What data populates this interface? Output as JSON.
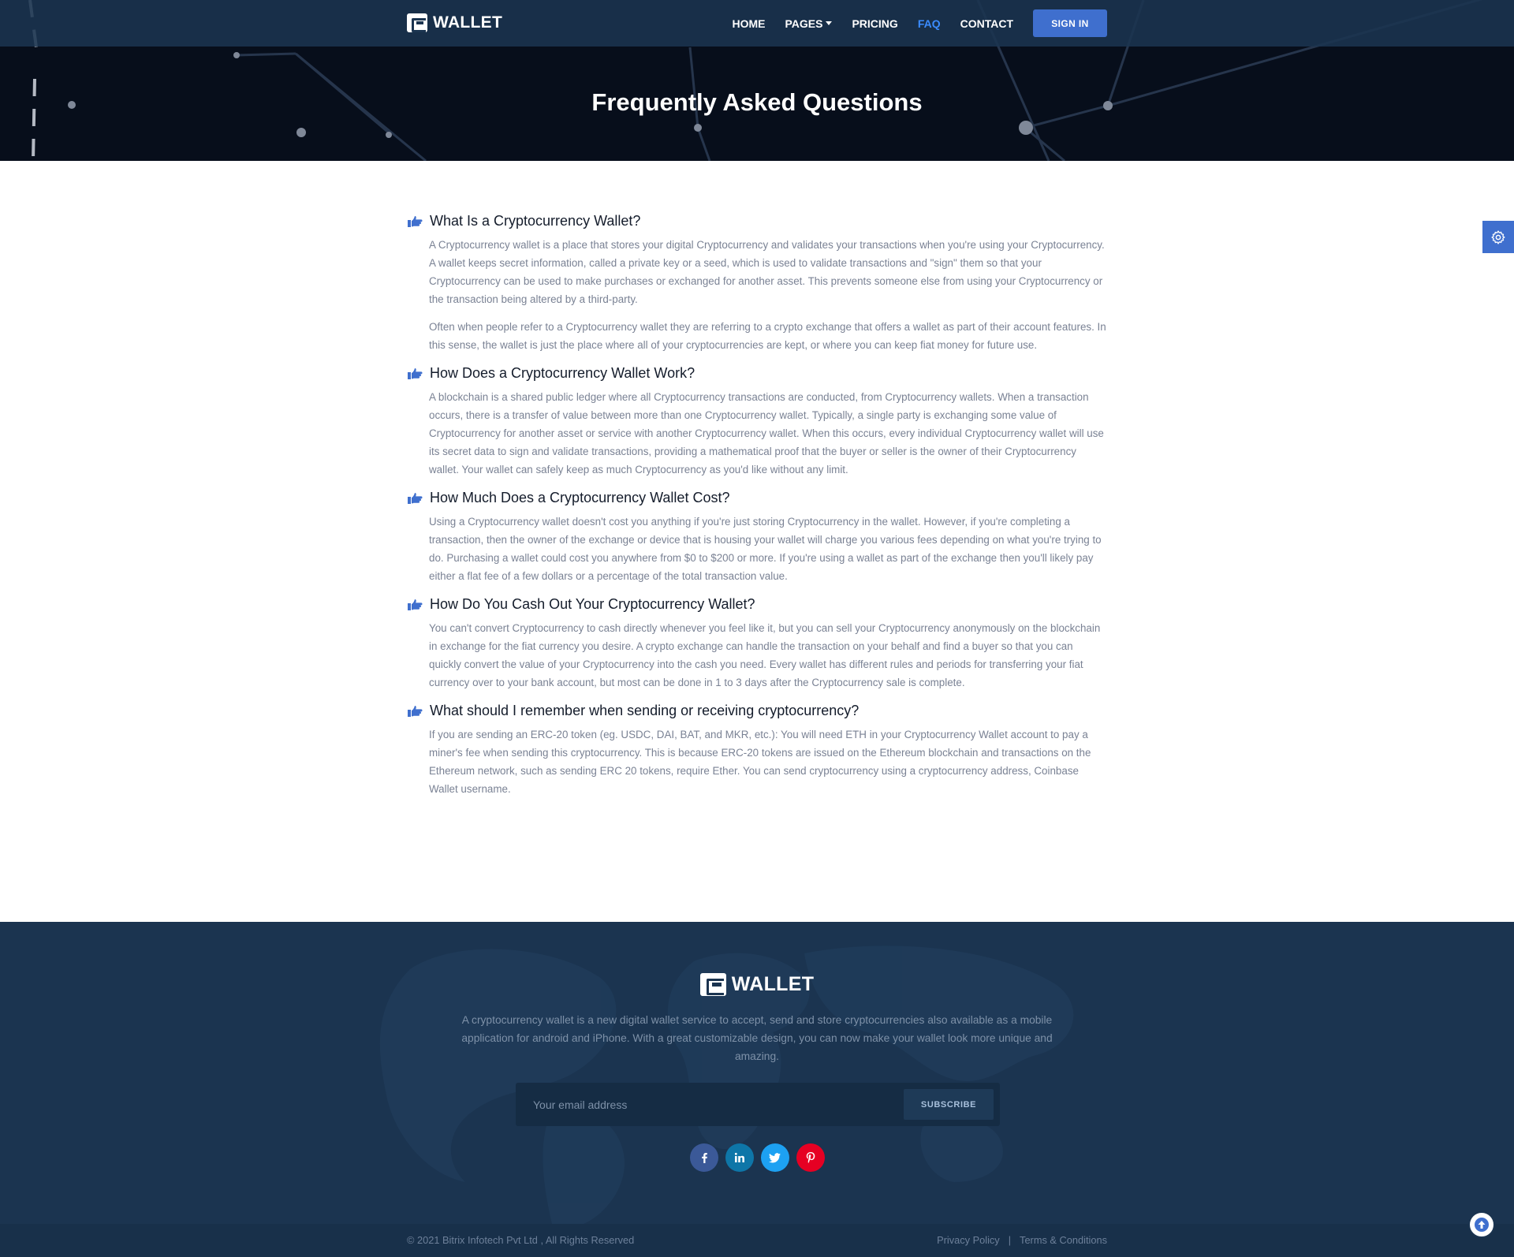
{
  "brand": {
    "name": "WALLET"
  },
  "nav": {
    "items": [
      {
        "label": "HOME",
        "active": false
      },
      {
        "label": "PAGES",
        "active": false,
        "dropdown": true
      },
      {
        "label": "PRICING",
        "active": false
      },
      {
        "label": "FAQ",
        "active": true
      },
      {
        "label": "CONTACT",
        "active": false
      }
    ],
    "signin_label": "SIGN IN"
  },
  "hero": {
    "title": "Frequently Asked Questions"
  },
  "faq": [
    {
      "question": "What Is a Cryptocurrency Wallet?",
      "answers": [
        "A Cryptocurrency wallet is a place that stores your digital Cryptocurrency and validates your transactions when you're using your Cryptocurrency. A wallet keeps secret information, called a private key or a seed, which is used to validate transactions and \"sign\" them so that your Cryptocurrency can be used to make purchases or exchanged for another asset. This prevents someone else from using your Cryptocurrency or the transaction being altered by a third-party.",
        "Often when people refer to a Cryptocurrency wallet they are referring to a crypto exchange that offers a wallet as part of their account features. In this sense, the wallet is just the place where all of your cryptocurrencies are kept, or where you can keep fiat money for future use."
      ]
    },
    {
      "question": "How Does a Cryptocurrency Wallet Work?",
      "answers": [
        "A blockchain is a shared public ledger where all Cryptocurrency transactions are conducted, from Cryptocurrency wallets. When a transaction occurs, there is a transfer of value between more than one Cryptocurrency wallet. Typically, a single party is exchanging some value of Cryptocurrency for another asset or service with another Cryptocurrency wallet. When this occurs, every individual Cryptocurrency wallet will use its secret data to sign and validate transactions, providing a mathematical proof that the buyer or seller is the owner of their Cryptocurrency wallet. Your wallet can safely keep as much Cryptocurrency as you'd like without any limit."
      ]
    },
    {
      "question": "How Much Does a Cryptocurrency Wallet Cost?",
      "answers": [
        "Using a Cryptocurrency wallet doesn't cost you anything if you're just storing Cryptocurrency in the wallet. However, if you're completing a transaction, then the owner of the exchange or device that is housing your wallet will charge you various fees depending on what you're trying to do. Purchasing a wallet could cost you anywhere from $0 to $200 or more. If you're using a wallet as part of the exchange then you'll likely pay either a flat fee of a few dollars or a percentage of the total transaction value."
      ]
    },
    {
      "question": "How Do You Cash Out Your Cryptocurrency Wallet?",
      "answers": [
        "You can't convert Cryptocurrency to cash directly whenever you feel like it, but you can sell your Cryptocurrency anonymously on the blockchain in exchange for the fiat currency you desire. A crypto exchange can handle the transaction on your behalf and find a buyer so that you can quickly convert the value of your Cryptocurrency into the cash you need. Every wallet has different rules and periods for transferring your fiat currency over to your bank account, but most can be done in 1 to 3 days after the Cryptocurrency sale is complete."
      ]
    },
    {
      "question": "What should I remember when sending or receiving cryptocurrency?",
      "answers": [
        "If you are sending an ERC-20 token (eg. USDC, DAI, BAT, and MKR, etc.): You will need ETH in your Cryptocurrency Wallet account to pay a miner's fee when sending this cryptocurrency. This is because ERC-20 tokens are issued on the Ethereum blockchain and transactions on the Ethereum network, such as sending ERC 20 tokens, require Ether. You can send cryptocurrency using a cryptocurrency address, Coinbase Wallet username."
      ]
    }
  ],
  "footer": {
    "description": "A cryptocurrency wallet is a new digital wallet service to accept, send and store cryptocurrencies also available as a mobile application for android and iPhone. With a great customizable design, you can now make your wallet look more unique and amazing.",
    "subscribe": {
      "placeholder": "Your email address",
      "button_label": "SUBSCRIBE"
    },
    "socials": [
      {
        "name": "facebook-icon",
        "glyph": "f",
        "color": "#3b5998"
      },
      {
        "name": "linkedin-icon",
        "glyph": "in",
        "color": "#0e76a8"
      },
      {
        "name": "twitter-icon",
        "glyph": "t",
        "color": "#1da1f2"
      },
      {
        "name": "pinterest-icon",
        "glyph": "p",
        "color": "#e60023"
      }
    ],
    "copyright": "© 2021 Bitrix Infotech Pvt Ltd , All Rights Reserved",
    "links": [
      "Privacy Policy",
      "Terms & Conditions"
    ],
    "separator": "|"
  },
  "colors": {
    "accent": "#3f6fce",
    "nav_bg": "#1b3450",
    "hero_bg": "#070e1b",
    "footer_bg": "#1b3450",
    "active_link": "#3b8cff"
  }
}
